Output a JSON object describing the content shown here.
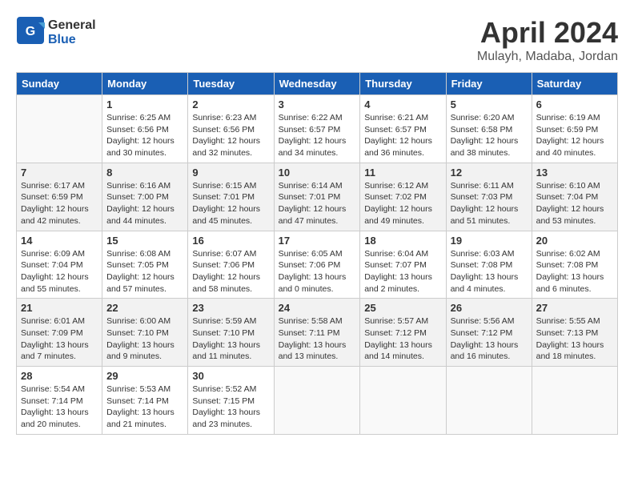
{
  "logo": {
    "text_general": "General",
    "text_blue": "Blue"
  },
  "title": "April 2024",
  "location": "Mulayh, Madaba, Jordan",
  "days_of_week": [
    "Sunday",
    "Monday",
    "Tuesday",
    "Wednesday",
    "Thursday",
    "Friday",
    "Saturday"
  ],
  "weeks": [
    [
      {
        "day": "",
        "sunrise": "",
        "sunset": "",
        "daylight": ""
      },
      {
        "day": "1",
        "sunrise": "Sunrise: 6:25 AM",
        "sunset": "Sunset: 6:56 PM",
        "daylight": "Daylight: 12 hours and 30 minutes."
      },
      {
        "day": "2",
        "sunrise": "Sunrise: 6:23 AM",
        "sunset": "Sunset: 6:56 PM",
        "daylight": "Daylight: 12 hours and 32 minutes."
      },
      {
        "day": "3",
        "sunrise": "Sunrise: 6:22 AM",
        "sunset": "Sunset: 6:57 PM",
        "daylight": "Daylight: 12 hours and 34 minutes."
      },
      {
        "day": "4",
        "sunrise": "Sunrise: 6:21 AM",
        "sunset": "Sunset: 6:57 PM",
        "daylight": "Daylight: 12 hours and 36 minutes."
      },
      {
        "day": "5",
        "sunrise": "Sunrise: 6:20 AM",
        "sunset": "Sunset: 6:58 PM",
        "daylight": "Daylight: 12 hours and 38 minutes."
      },
      {
        "day": "6",
        "sunrise": "Sunrise: 6:19 AM",
        "sunset": "Sunset: 6:59 PM",
        "daylight": "Daylight: 12 hours and 40 minutes."
      }
    ],
    [
      {
        "day": "7",
        "sunrise": "Sunrise: 6:17 AM",
        "sunset": "Sunset: 6:59 PM",
        "daylight": "Daylight: 12 hours and 42 minutes."
      },
      {
        "day": "8",
        "sunrise": "Sunrise: 6:16 AM",
        "sunset": "Sunset: 7:00 PM",
        "daylight": "Daylight: 12 hours and 44 minutes."
      },
      {
        "day": "9",
        "sunrise": "Sunrise: 6:15 AM",
        "sunset": "Sunset: 7:01 PM",
        "daylight": "Daylight: 12 hours and 45 minutes."
      },
      {
        "day": "10",
        "sunrise": "Sunrise: 6:14 AM",
        "sunset": "Sunset: 7:01 PM",
        "daylight": "Daylight: 12 hours and 47 minutes."
      },
      {
        "day": "11",
        "sunrise": "Sunrise: 6:12 AM",
        "sunset": "Sunset: 7:02 PM",
        "daylight": "Daylight: 12 hours and 49 minutes."
      },
      {
        "day": "12",
        "sunrise": "Sunrise: 6:11 AM",
        "sunset": "Sunset: 7:03 PM",
        "daylight": "Daylight: 12 hours and 51 minutes."
      },
      {
        "day": "13",
        "sunrise": "Sunrise: 6:10 AM",
        "sunset": "Sunset: 7:04 PM",
        "daylight": "Daylight: 12 hours and 53 minutes."
      }
    ],
    [
      {
        "day": "14",
        "sunrise": "Sunrise: 6:09 AM",
        "sunset": "Sunset: 7:04 PM",
        "daylight": "Daylight: 12 hours and 55 minutes."
      },
      {
        "day": "15",
        "sunrise": "Sunrise: 6:08 AM",
        "sunset": "Sunset: 7:05 PM",
        "daylight": "Daylight: 12 hours and 57 minutes."
      },
      {
        "day": "16",
        "sunrise": "Sunrise: 6:07 AM",
        "sunset": "Sunset: 7:06 PM",
        "daylight": "Daylight: 12 hours and 58 minutes."
      },
      {
        "day": "17",
        "sunrise": "Sunrise: 6:05 AM",
        "sunset": "Sunset: 7:06 PM",
        "daylight": "Daylight: 13 hours and 0 minutes."
      },
      {
        "day": "18",
        "sunrise": "Sunrise: 6:04 AM",
        "sunset": "Sunset: 7:07 PM",
        "daylight": "Daylight: 13 hours and 2 minutes."
      },
      {
        "day": "19",
        "sunrise": "Sunrise: 6:03 AM",
        "sunset": "Sunset: 7:08 PM",
        "daylight": "Daylight: 13 hours and 4 minutes."
      },
      {
        "day": "20",
        "sunrise": "Sunrise: 6:02 AM",
        "sunset": "Sunset: 7:08 PM",
        "daylight": "Daylight: 13 hours and 6 minutes."
      }
    ],
    [
      {
        "day": "21",
        "sunrise": "Sunrise: 6:01 AM",
        "sunset": "Sunset: 7:09 PM",
        "daylight": "Daylight: 13 hours and 7 minutes."
      },
      {
        "day": "22",
        "sunrise": "Sunrise: 6:00 AM",
        "sunset": "Sunset: 7:10 PM",
        "daylight": "Daylight: 13 hours and 9 minutes."
      },
      {
        "day": "23",
        "sunrise": "Sunrise: 5:59 AM",
        "sunset": "Sunset: 7:10 PM",
        "daylight": "Daylight: 13 hours and 11 minutes."
      },
      {
        "day": "24",
        "sunrise": "Sunrise: 5:58 AM",
        "sunset": "Sunset: 7:11 PM",
        "daylight": "Daylight: 13 hours and 13 minutes."
      },
      {
        "day": "25",
        "sunrise": "Sunrise: 5:57 AM",
        "sunset": "Sunset: 7:12 PM",
        "daylight": "Daylight: 13 hours and 14 minutes."
      },
      {
        "day": "26",
        "sunrise": "Sunrise: 5:56 AM",
        "sunset": "Sunset: 7:12 PM",
        "daylight": "Daylight: 13 hours and 16 minutes."
      },
      {
        "day": "27",
        "sunrise": "Sunrise: 5:55 AM",
        "sunset": "Sunset: 7:13 PM",
        "daylight": "Daylight: 13 hours and 18 minutes."
      }
    ],
    [
      {
        "day": "28",
        "sunrise": "Sunrise: 5:54 AM",
        "sunset": "Sunset: 7:14 PM",
        "daylight": "Daylight: 13 hours and 20 minutes."
      },
      {
        "day": "29",
        "sunrise": "Sunrise: 5:53 AM",
        "sunset": "Sunset: 7:14 PM",
        "daylight": "Daylight: 13 hours and 21 minutes."
      },
      {
        "day": "30",
        "sunrise": "Sunrise: 5:52 AM",
        "sunset": "Sunset: 7:15 PM",
        "daylight": "Daylight: 13 hours and 23 minutes."
      },
      {
        "day": "",
        "sunrise": "",
        "sunset": "",
        "daylight": ""
      },
      {
        "day": "",
        "sunrise": "",
        "sunset": "",
        "daylight": ""
      },
      {
        "day": "",
        "sunrise": "",
        "sunset": "",
        "daylight": ""
      },
      {
        "day": "",
        "sunrise": "",
        "sunset": "",
        "daylight": ""
      }
    ]
  ]
}
